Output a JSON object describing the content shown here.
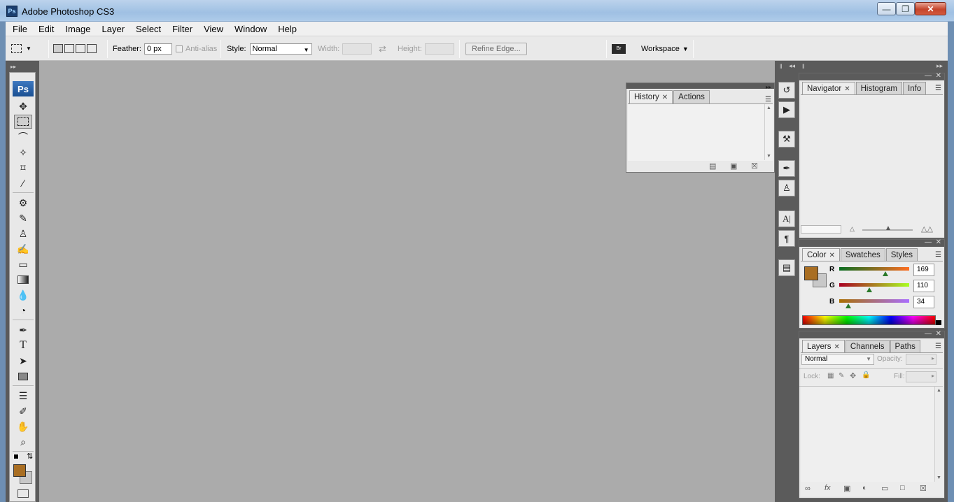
{
  "window": {
    "title": "Adobe Photoshop CS3",
    "app_icon_text": "Ps",
    "min_icon": "minimize-icon",
    "max_icon": "maximize-icon",
    "close_icon": "close-icon"
  },
  "menu": [
    "File",
    "Edit",
    "Image",
    "Layer",
    "Select",
    "Filter",
    "View",
    "Window",
    "Help"
  ],
  "options_bar": {
    "feather_label": "Feather:",
    "feather_value": "0 px",
    "antialias_label": "Anti-alias",
    "style_label": "Style:",
    "style_value": "Normal",
    "width_label": "Width:",
    "height_label": "Height:",
    "refine_edge_label": "Refine Edge...",
    "workspace_label": "Workspace"
  },
  "toolbox": {
    "logo": "Ps"
  },
  "history_panel": {
    "tabs": [
      "History",
      "Actions"
    ],
    "active_tab": "History"
  },
  "navigator_panel": {
    "tabs": [
      "Navigator",
      "Histogram",
      "Info"
    ],
    "active_tab": "Navigator"
  },
  "color_panel": {
    "tabs": [
      "Color",
      "Swatches",
      "Styles"
    ],
    "active_tab": "Color",
    "foreground_color": "#a96e22",
    "background_color": "#c8c8c8",
    "channels": [
      {
        "label": "R",
        "value": "169",
        "level": 0.663
      },
      {
        "label": "G",
        "value": "110",
        "level": 0.431
      },
      {
        "label": "B",
        "value": "34",
        "level": 0.133
      }
    ]
  },
  "layers_panel": {
    "tabs": [
      "Layers",
      "Channels",
      "Paths"
    ],
    "active_tab": "Layers",
    "blend_mode": "Normal",
    "opacity_label": "Opacity:",
    "lock_label": "Lock:",
    "fill_label": "Fill:"
  },
  "colors": {
    "workspace": "#ababab",
    "panel_dark": "#5b5b5b",
    "foreground": "#a96e22"
  }
}
